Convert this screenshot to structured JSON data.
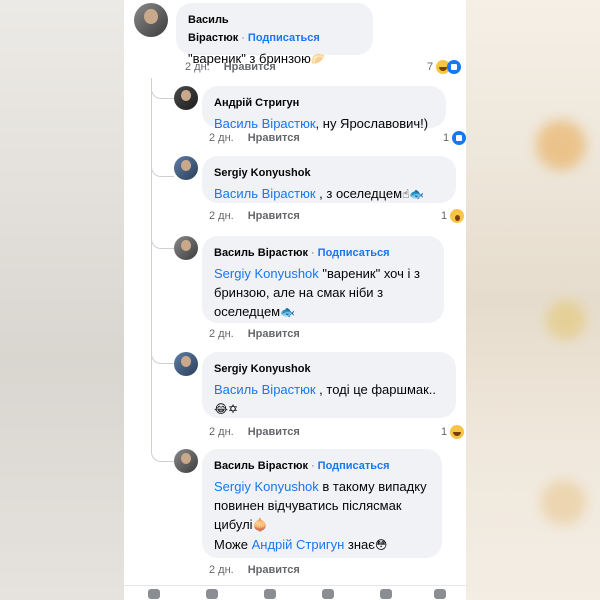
{
  "comments": [
    {
      "author": "Василь Вірастюк",
      "follow": "Подписаться",
      "text": "\"вареник\" з бринзою",
      "emoji": "🥟",
      "time": "2 дн.",
      "like": "Нравится",
      "count": "7"
    },
    {
      "author": "Андрій Стригун",
      "mention": "Василь Вірастюк",
      "text": ", ну Ярославович!)",
      "time": "2 дн.",
      "like": "Нравится",
      "count": "1"
    },
    {
      "author": "Sergiy Konyushok",
      "mention": "Василь Вірастюк",
      "text": " , з оселедцем",
      "emoji": "☝🐟",
      "time": "2 дн.",
      "like": "Нравится",
      "count": "1"
    },
    {
      "author": "Василь Вірастюк",
      "follow": "Подписаться",
      "mention": "Sergiy Konyushok",
      "text_line1": " \"вареник\" хоч і з",
      "text_line2": "бринзою, але на смак ніби з",
      "text_line3": "оселедцем",
      "emoji": "🐟",
      "time": "2 дн.",
      "like": "Нравится"
    },
    {
      "author": "Sergiy Konyushok",
      "mention": "Василь Вірастюк",
      "text": " , тоді це фаршмак..",
      "emoji": "😂✡",
      "time": "2 дн.",
      "like": "Нравится",
      "count": "1"
    },
    {
      "author": "Василь Вірастюк",
      "follow": "Подписаться",
      "mention": "Sergiy Konyushok",
      "text_line1": " в такому випадку",
      "text_line2": "повинен відчуватись післясмак",
      "text_line3": "цибулі",
      "emoji": "🧅",
      "line4_prefix": "Може ",
      "line4_mention": "Андрій Стригун",
      "line4_suffix": " знає",
      "line4_emoji": "😳",
      "time": "2 дн.",
      "like": "Нравится"
    }
  ],
  "colors": {
    "accent": "#1877f2",
    "bubble": "#f0f2f5",
    "meta": "#65676b"
  }
}
